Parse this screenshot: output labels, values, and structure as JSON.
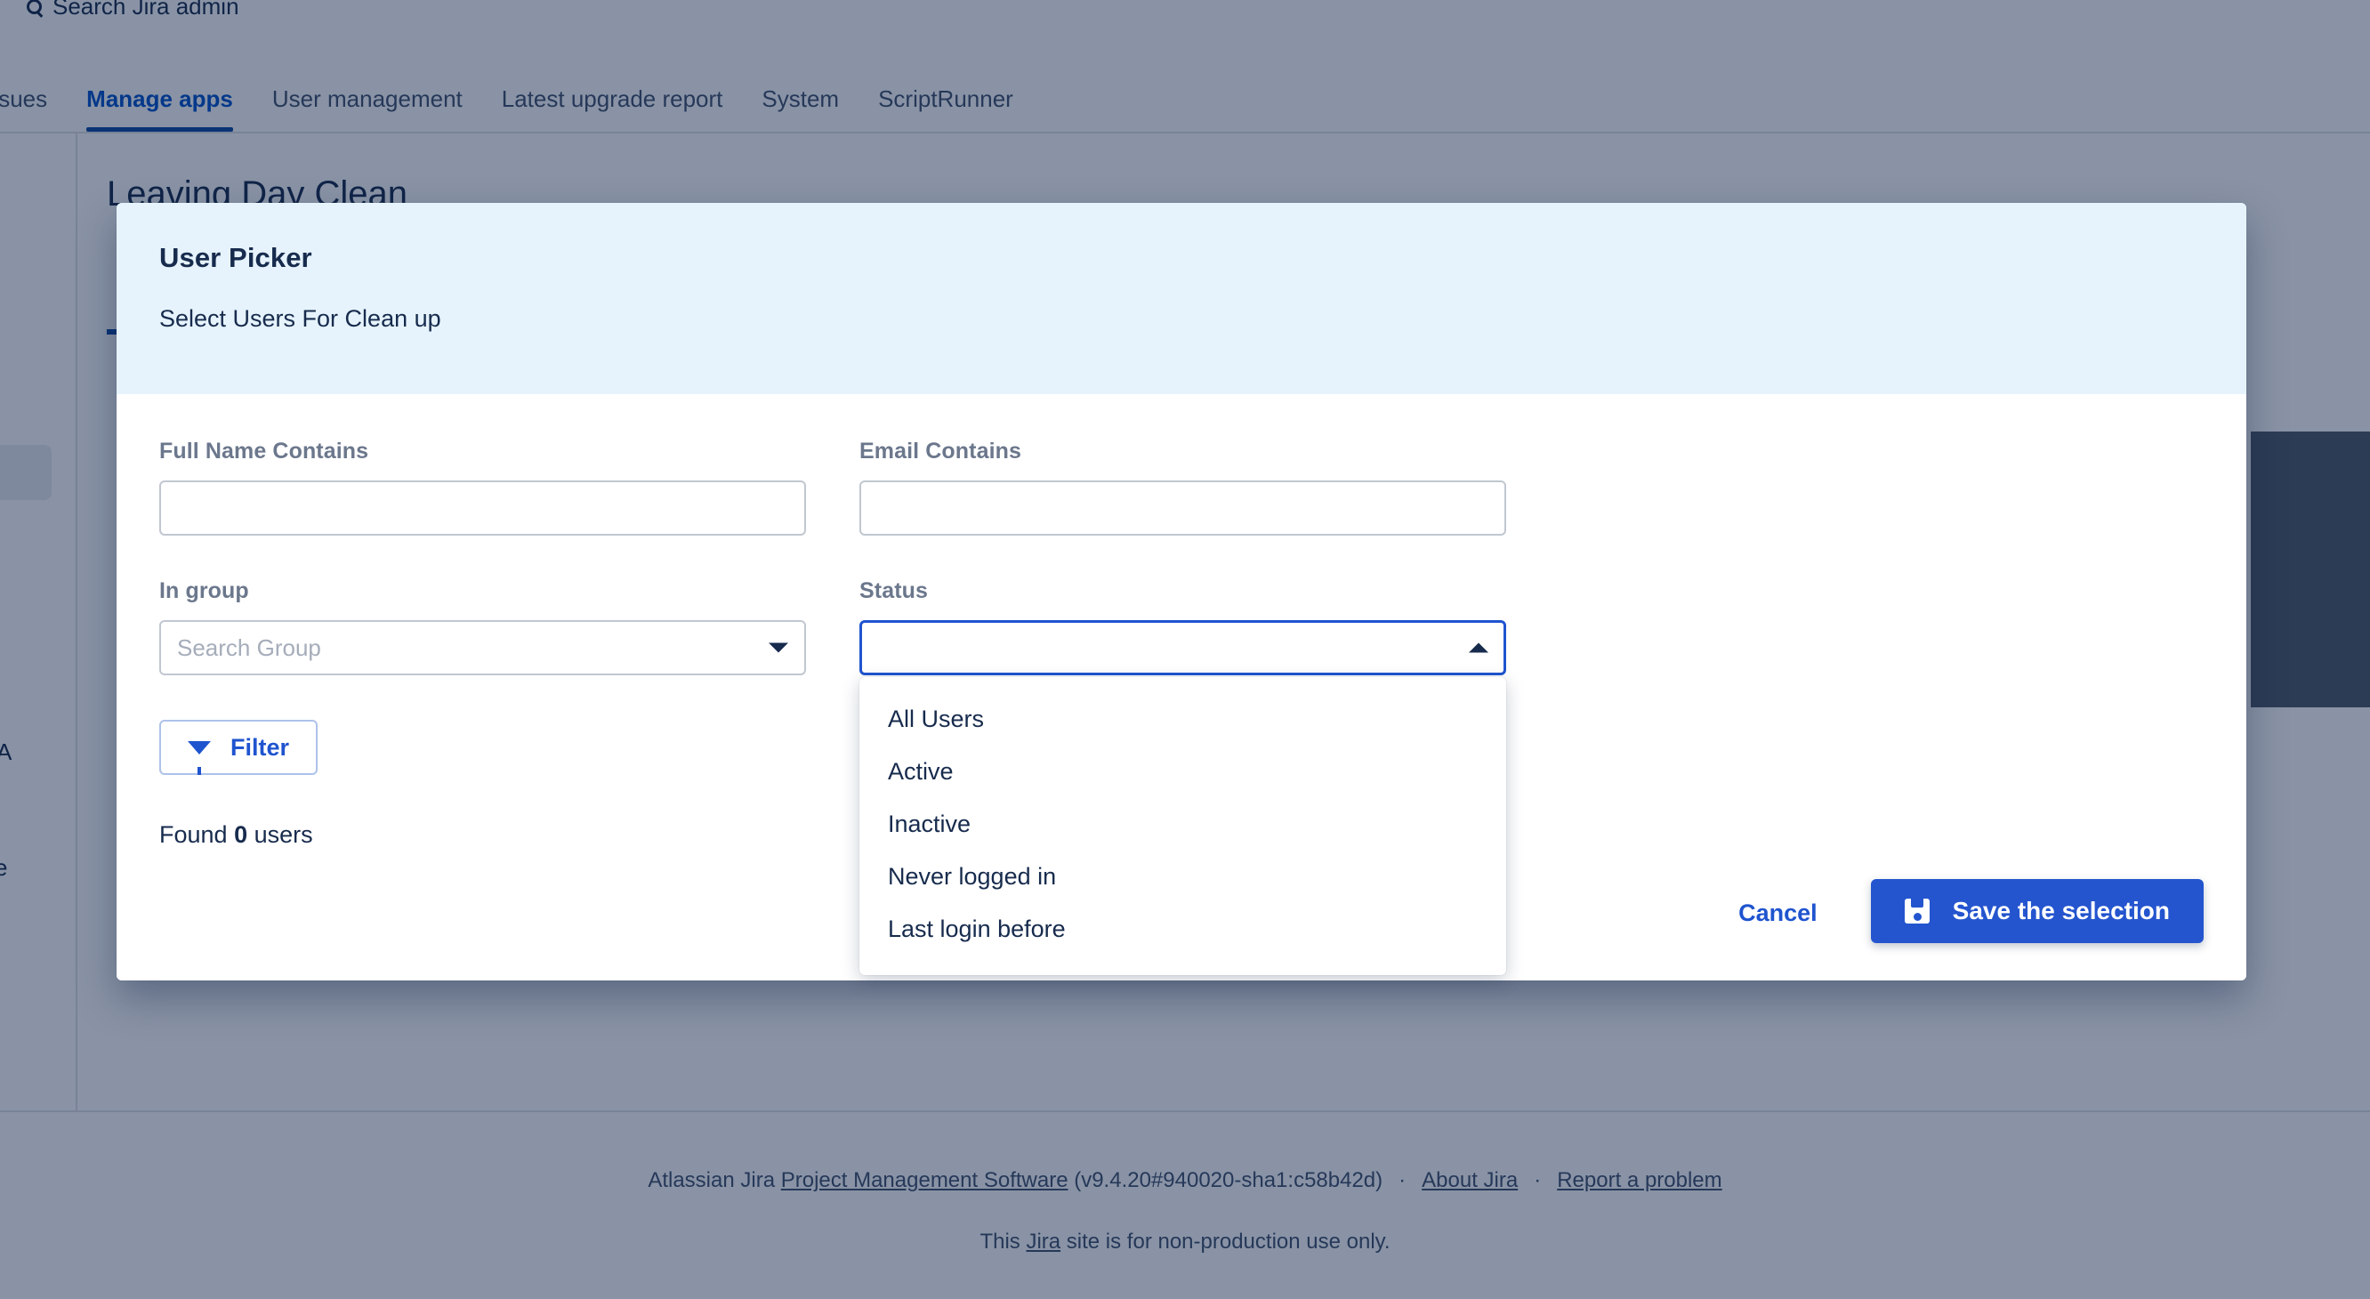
{
  "background": {
    "search": {
      "label": "Search Jira admin",
      "icon": "search-icon"
    },
    "nav_tabs": [
      {
        "label": "Issues",
        "active": false
      },
      {
        "label": "Manage apps",
        "active": true
      },
      {
        "label": "User management",
        "active": false
      },
      {
        "label": "Latest upgrade report",
        "active": false
      },
      {
        "label": "System",
        "active": false
      },
      {
        "label": "ScriptRunner",
        "active": false
      }
    ],
    "content_title": "Leaving Day Clean",
    "left_fragment_a": "A",
    "left_fragment_b": "e"
  },
  "footer": {
    "prefix": "Atlassian Jira ",
    "product_link": "Project Management Software",
    "version": " (v9.4.20#940020-sha1:c58b42d)",
    "separator": "·",
    "about_link": "About Jira",
    "report_link": "Report a problem",
    "notice_before": "This ",
    "notice_link": "Jira",
    "notice_after": " site is for non-production use only."
  },
  "dialog": {
    "title": "User Picker",
    "subtitle": "Select Users For Clean up",
    "fields": {
      "full_name": {
        "label": "Full Name Contains",
        "value": "",
        "placeholder": ""
      },
      "email": {
        "label": "Email Contains",
        "value": "",
        "placeholder": ""
      },
      "in_group": {
        "label": "In group",
        "value": "",
        "placeholder": "Search Group"
      },
      "status": {
        "label": "Status",
        "value": "",
        "placeholder": "",
        "expanded": true,
        "options": [
          "All Users",
          "Active",
          "Inactive",
          "Never logged in",
          "Last login before"
        ]
      }
    },
    "filter_button": {
      "label": "Filter",
      "icon": "funnel-icon"
    },
    "found": {
      "prefix": "Found ",
      "count": "0",
      "suffix": " users"
    },
    "cancel_label": "Cancel",
    "save_label": "Save the selection",
    "save_icon": "floppy-disk-icon"
  },
  "colors": {
    "accent_blue": "#2455cf",
    "link_blue": "#1f54cf",
    "header_band": "#e6f3fc",
    "label_gray": "#6b778c",
    "text_dark": "#172b4d",
    "border_gray": "#c1c7d0",
    "tab_active": "#0052cc"
  }
}
